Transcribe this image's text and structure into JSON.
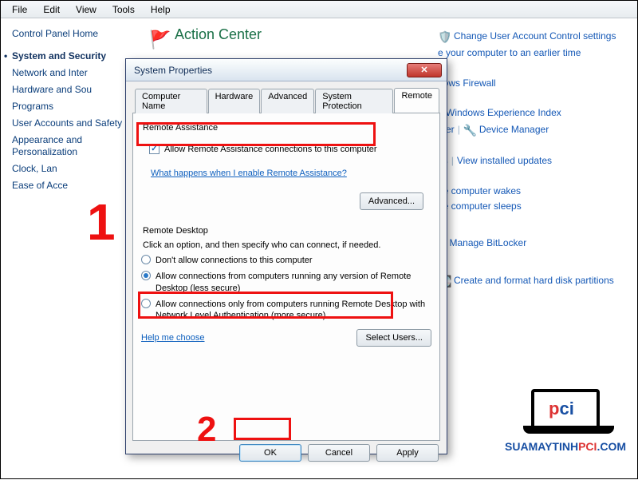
{
  "menu": {
    "file": "File",
    "edit": "Edit",
    "view": "View",
    "tools": "Tools",
    "help": "Help"
  },
  "cp": {
    "home": "Control Panel Home",
    "items": [
      "System and Security",
      "Network and Inter",
      "Hardware and Sou",
      "Programs",
      "User Accounts and Safety",
      "Appearance and Personalization",
      "Clock, Lan",
      "Ease of Acce"
    ]
  },
  "ac": {
    "title": "Action Center"
  },
  "rlinks": {
    "l1": "Change User Account Control settings",
    "l2": "e your computer to an earlier time",
    "l3": "dows Firewall",
    "l4": "e Windows Experience Index",
    "l5": "uter",
    "l6": "Device Manager",
    "l7": "es",
    "l8": "View installed updates",
    "l9": "he computer wakes",
    "l10": "he computer sleeps",
    "l11": ":",
    "l12": "Manage BitLocker",
    "l13": "Create and format hard disk partitions"
  },
  "dlg": {
    "title": "System Properties",
    "tabs": {
      "t1": "Computer Name",
      "t2": "Hardware",
      "t3": "Advanced",
      "t4": "System Protection",
      "t5": "Remote"
    },
    "ra": {
      "group": "Remote Assistance",
      "chk": "Allow Remote Assistance connections to this computer",
      "help": "What happens when I enable Remote Assistance?",
      "adv": "Advanced..."
    },
    "rd": {
      "group": "Remote Desktop",
      "desc": "Click an option, and then specify who can connect, if needed.",
      "r1": "Don't allow connections to this computer",
      "r2": "Allow connections from computers running any version of Remote Desktop (less secure)",
      "r3": "Allow connections only from computers running Remote Desktop with Network Level Authentication (more secure)",
      "help": "Help me choose",
      "sel": "Select Users..."
    },
    "btn": {
      "ok": "OK",
      "cancel": "Cancel",
      "apply": "Apply"
    }
  },
  "anno": {
    "n1": "1",
    "n2": "2"
  },
  "wm": {
    "text_blue": "SUAMAYTINH",
    "text_red": "PCI",
    "text_suf": ".COM"
  }
}
